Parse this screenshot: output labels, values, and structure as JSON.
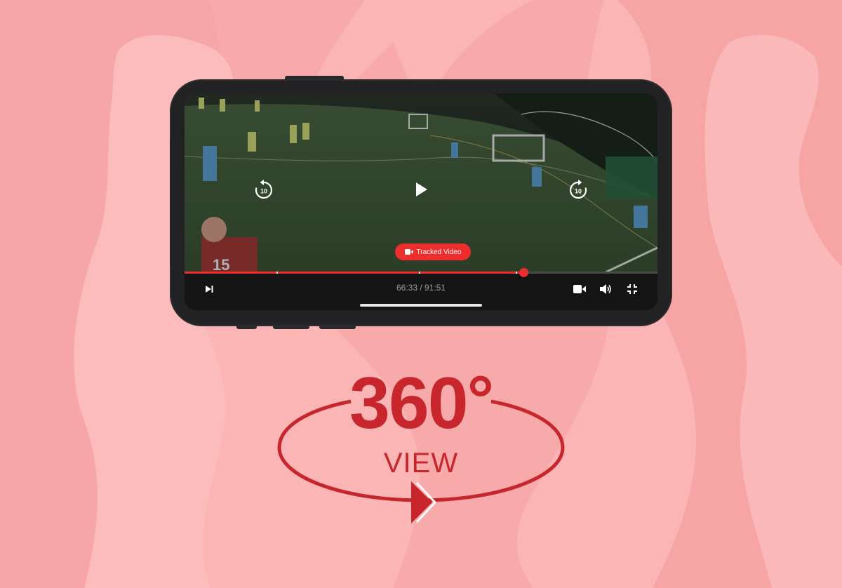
{
  "player": {
    "pill_label": "Tracked Video",
    "time_label": "66:33 / 91:51",
    "progress": 0.7165,
    "chapter_marks": [
      0.195,
      0.496,
      0.7
    ],
    "skip_back_label": "10",
    "skip_forward_label": "10"
  },
  "icons": {
    "next": "skip-next-icon",
    "camera": "video-camera-icon",
    "volume": "volume-icon",
    "exit_fullscreen": "exit-fullscreen-icon",
    "play": "play-icon",
    "rewind": "rewind-10-icon",
    "forward": "forward-10-icon"
  },
  "badge": {
    "number": "360",
    "degree": "°",
    "caption": "VIEW"
  },
  "colors": {
    "accent": "#ee2d2d",
    "badge_red": "#c8262d",
    "background": "#fbb5b5"
  }
}
